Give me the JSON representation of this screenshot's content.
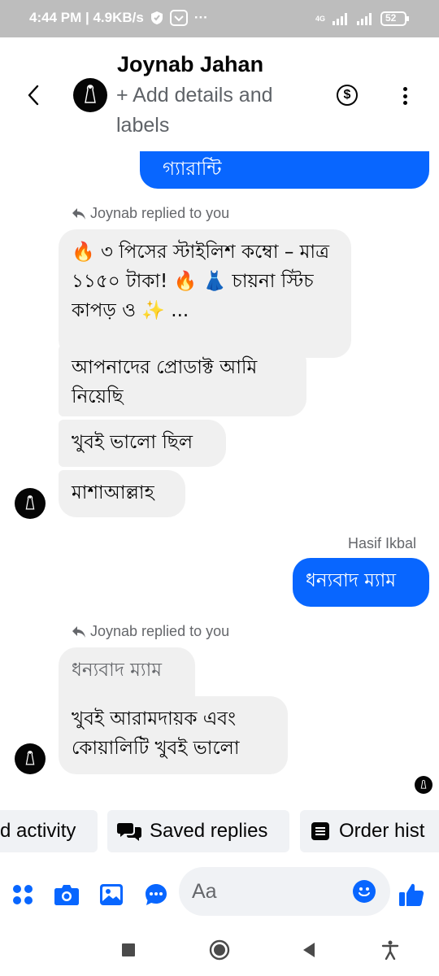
{
  "status_bar": {
    "time_speed": "4:44 PM | 4.9KB/s",
    "more": "···",
    "network": "4G",
    "battery": "52"
  },
  "header": {
    "contact_name": "Joynab Jahan",
    "subtitle": "+ Add details and labels"
  },
  "messages": {
    "partial_outgoing": "গ্যারান্টি",
    "reply_note_1": "Joynab replied to you",
    "quoted_1": "🔥 ৩ পিসের স্টাইলিশ কম্বো – মাত্র ১১৫০ টাকা! 🔥 👗 চায়না স্টিচ কাপড় ও ✨ ...",
    "incoming_1": "আপনাদের প্রোডাক্ট আমি নিয়েছি",
    "incoming_2": "খুবই ভালো ছিল",
    "incoming_3": "মাশাআল্লাহ",
    "sender_name": "Hasif Ikbal",
    "outgoing_1": "ধন্যবাদ ম্যাম",
    "reply_note_2": "Joynab replied to you",
    "quoted_2": "ধন্যবাদ ম্যাম",
    "incoming_4": "খুবই আরামদায়ক এবং কোয়ালিটি খুবই ভালো"
  },
  "quick_actions": {
    "chip_1": "d activity",
    "chip_2": "Saved replies",
    "chip_3": "Order hist"
  },
  "composer": {
    "placeholder": "Aa"
  },
  "icons": {
    "back": "chevron-left-icon",
    "payment": "dollar-circle-icon",
    "more": "kebab-icon",
    "apps": "apps-grid-icon",
    "camera": "camera-icon",
    "gallery": "image-icon",
    "chat": "chat-bubble-icon",
    "emoji": "emoji-icon",
    "like": "thumbs-up-icon"
  },
  "colors": {
    "accent": "#0866ff",
    "incoming_bubble": "#f0f0f0",
    "status_bar": "#bdbdbd"
  }
}
